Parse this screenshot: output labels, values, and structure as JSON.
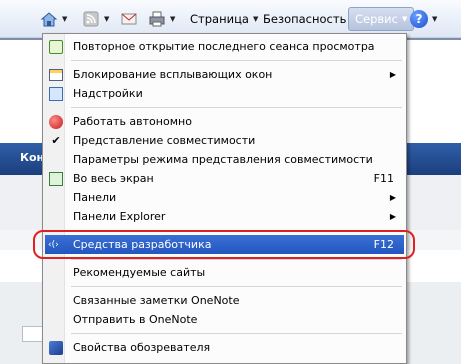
{
  "toolbar": {
    "page_label": "Страница",
    "security_label": "Безопасность",
    "service_label": "Сервис"
  },
  "background": {
    "band_text": "Кон"
  },
  "menu": {
    "items": [
      {
        "label": "Повторное открытие последнего сеанса просмотра"
      },
      {
        "label": "Блокирование всплывающих окон",
        "submenu": "▶"
      },
      {
        "label": "Надстройки"
      },
      {
        "label": "Работать автономно"
      },
      {
        "label": "Представление совместимости",
        "check": "✔"
      },
      {
        "label": "Параметры режима представления совместимости"
      },
      {
        "label": "Во весь экран",
        "shortcut": "F11"
      },
      {
        "label": "Панели",
        "submenu": "▶"
      },
      {
        "label": "Панели Explorer",
        "submenu": "▶"
      },
      {
        "label": "Средства разработчика",
        "shortcut": "F12"
      },
      {
        "label": "Рекомендуемые сайты"
      },
      {
        "label": "Связанные заметки OneNote"
      },
      {
        "label": "Отправить в OneNote"
      },
      {
        "label": "Свойства обозревателя"
      }
    ]
  },
  "colors": {
    "highlight": "#2357c0",
    "ring": "#e02020"
  }
}
